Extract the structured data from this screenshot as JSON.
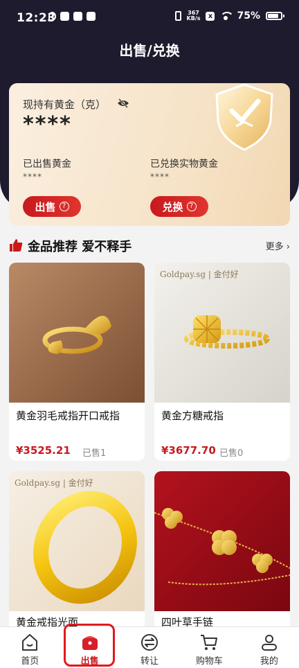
{
  "status_bar": {
    "time": "12:23",
    "network_speed_top": "367",
    "network_speed_unit": "KB/s",
    "battery": "75%"
  },
  "page": {
    "title": "出售/兑换"
  },
  "gold_card": {
    "held_label": "现持有黄金（克）",
    "held_value": "****",
    "sold_label": "已出售黄金",
    "sold_value": "****",
    "exchanged_label": "已兑换实物黄金",
    "exchanged_value": "****",
    "sell_button": "出售",
    "exchange_button": "兑换"
  },
  "section": {
    "title": "金品推荐 爱不释手",
    "more": "更多"
  },
  "products": [
    {
      "name": "黄金羽毛戒指开口戒指",
      "price": "¥3525.21",
      "sold": "已售1"
    },
    {
      "name": "黄金方糖戒指",
      "price": "¥3677.70",
      "sold": "已售0",
      "brand": "Goldpay.sg | 金付好"
    },
    {
      "name": "黄金戒指光面",
      "brand": "Goldpay.sg | 金付好"
    },
    {
      "name": "四叶草手链"
    }
  ],
  "tabbar": [
    {
      "label": "首页",
      "icon": "home-icon"
    },
    {
      "label": "出售",
      "icon": "wallet-icon",
      "active": true
    },
    {
      "label": "转让",
      "icon": "transfer-icon"
    },
    {
      "label": "购物车",
      "icon": "cart-icon"
    },
    {
      "label": "我的",
      "icon": "user-icon"
    }
  ],
  "colors": {
    "accent": "#c8191d",
    "header_bg": "#1f1b2e",
    "card_bg": "#f6e3c8"
  }
}
